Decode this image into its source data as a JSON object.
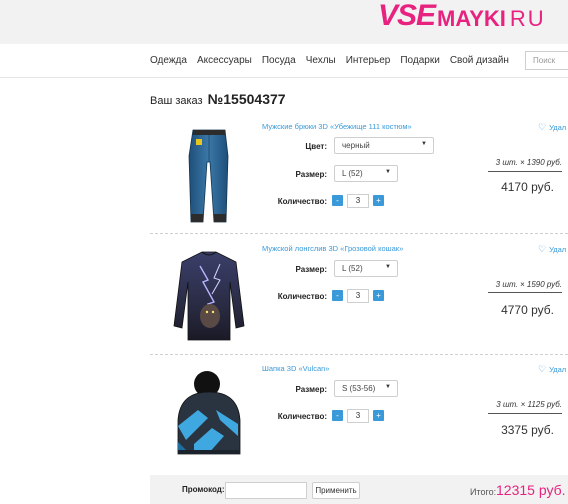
{
  "logo": {
    "part1": "VSE",
    "part2": "MAYKI",
    "part3": "RU"
  },
  "nav": [
    "Одежда",
    "Аксессуары",
    "Посуда",
    "Чехлы",
    "Интерьер",
    "Подарки",
    "Свой дизайн"
  ],
  "search": {
    "placeholder": "Поиск"
  },
  "order": {
    "label": "Ваш заказ",
    "number": "№15504377"
  },
  "labels": {
    "color": "Цвет:",
    "size": "Размер:",
    "quantity": "Количество:",
    "favorite": "Удал",
    "minus": "-",
    "plus": "+"
  },
  "items": [
    {
      "name": "Мужские брюки 3D «Убежище 111 костюм»",
      "color": "черный",
      "size": "L (52)",
      "qty": "3",
      "unit": "3 шт. × 1390 руб.",
      "total": "4170 руб."
    },
    {
      "name": "Мужской лонгслив 3D «Грозовой кошак»",
      "size": "L (52)",
      "qty": "3",
      "unit": "3 шт. × 1590 руб.",
      "total": "4770 руб."
    },
    {
      "name": "Шапка 3D «Vulcan»",
      "size": "S (53-56)",
      "qty": "3",
      "unit": "3 шт. × 1125 руб.",
      "total": "3375 руб."
    }
  ],
  "footer": {
    "promo_label": "Промокод:",
    "apply": "Применить",
    "total_label": "Итого:",
    "total_value": "12315 руб."
  },
  "colors": {
    "accent": "#e8227f",
    "link": "#3a9ad9"
  }
}
